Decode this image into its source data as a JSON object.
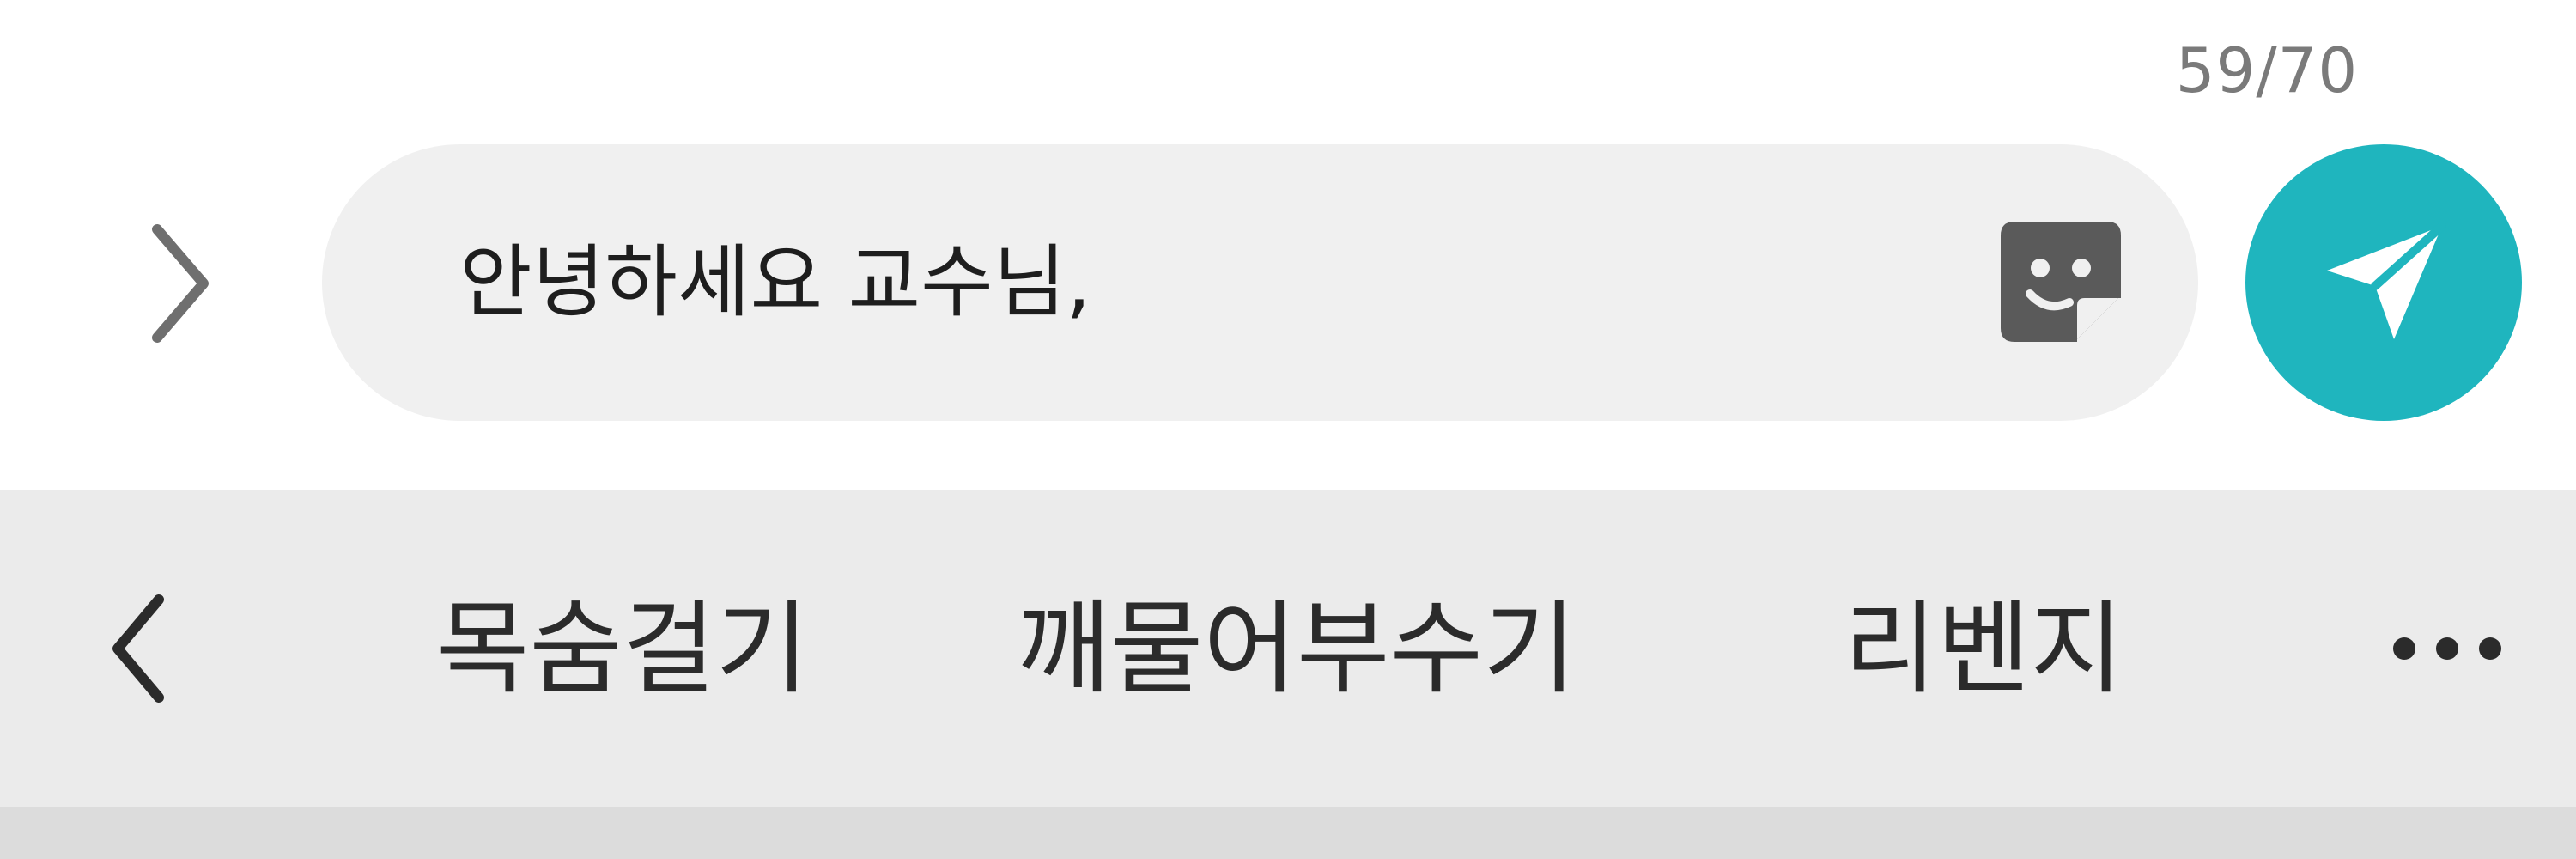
{
  "composer": {
    "char_counter": "59/70",
    "message_text": "안녕하세요 교수님,",
    "icons": {
      "expand": "chevron-right-icon",
      "sticker": "sticker-icon",
      "send": "paper-plane-icon"
    },
    "colors": {
      "send_button": "#1fb5be",
      "input_background": "#f0f0f0"
    }
  },
  "suggestions": {
    "items": [
      {
        "label": "목숨걸기"
      },
      {
        "label": "깨물어부수기"
      },
      {
        "label": "리벤지"
      }
    ],
    "icons": {
      "collapse": "chevron-left-icon",
      "more": "more-horizontal-icon"
    },
    "colors": {
      "bar_background": "#ebebeb"
    }
  }
}
